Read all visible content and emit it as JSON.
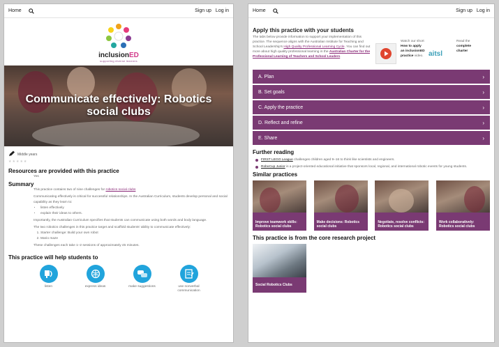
{
  "nav": {
    "home": "Home",
    "signup": "Sign up",
    "login": "Log in"
  },
  "logo": {
    "brand_prefix": "inclusion",
    "brand_suffix": "ED",
    "tagline": "supporting diverse learners"
  },
  "hero": {
    "title": "Communicate effectively: Robotics social clubs"
  },
  "meta": {
    "years": "Middle years",
    "stars": "★★★★★"
  },
  "resources": {
    "heading": "Resources are provided with this practice",
    "value": "Yes"
  },
  "summary": {
    "heading": "Summary",
    "p1_prefix": "This practice contains two of nine challenges for ",
    "p1_link": "robotics social clubs",
    "p2": "Communicating effectively is critical for successful relationships. In the Australian Curriculum, students develop personal and social capability as they learn to:",
    "bullets": [
      "listen effectively",
      "explain their ideas to others."
    ],
    "p3": "Importantly, the Australian Curriculum specifies that students can communicate using both words and body language.",
    "p4": "The two robotics challenges in this practice target and scaffold students' ability to communicate effectively:",
    "steps": [
      "Starter challenge: Build your own robot",
      "Mario maze"
    ],
    "p5": "These challenges each take 1–2 sessions of approximately 45 minutes."
  },
  "helps": {
    "heading": "This practice will help students to",
    "items": [
      {
        "label": "listen",
        "icon": "listen-icon"
      },
      {
        "label": "express ideas",
        "icon": "brain-icon"
      },
      {
        "label": "make suggestions",
        "icon": "speech-bubble-icon"
      },
      {
        "label": "use nonverbal communication",
        "icon": "notepad-icon"
      }
    ]
  },
  "apply": {
    "heading": "Apply this practice with your students",
    "text_1": "The tabs below provide information to support your implementation of this practice. The sequence aligns with the Australian Institute for Teaching and School Leadership's ",
    "link_1": "High Quality Professional Learning Cycle",
    "text_2": ". You can find out more about high quality professional learning in the ",
    "link_2": "Australian Charter for the Professional Learning of Teachers and School Leaders",
    "text_3": ".",
    "video_pre": "Watch our short",
    "video_bold": "How to apply an inclusionED practice",
    "video_post": "video.",
    "aitsl": "aitsl",
    "charter_pre": "Read the",
    "charter_bold": "complete charter"
  },
  "accordion": [
    "A. Plan",
    "B. Set goals",
    "C. Apply the practice",
    "D. Reflect and refine",
    "E. Share"
  ],
  "further": {
    "heading": "Further reading",
    "items": [
      {
        "link": "FIRST LEGO League",
        "text": " challenges children aged 9–16 to think like scientists and engineers."
      },
      {
        "link": "RoboCup Junior",
        "text": " is a project-oriented educational initiative that sponsors local, regional, and international robotic events for young students."
      }
    ]
  },
  "similar": {
    "heading": "Similar practices",
    "cards": [
      "Improve teamwork skills: Robotics social clubs",
      "Make decisions: Robotics social clubs",
      "Negotiate, resolve conflicts: Robotics social clubs",
      "Work collaboratively: Robotics social clubs"
    ]
  },
  "project": {
    "heading": "This practice is from the core research project",
    "card": "Social Robotics Clubs"
  },
  "colors": {
    "accent": "#7a3a73",
    "icon_blue": "#21a4dc"
  }
}
